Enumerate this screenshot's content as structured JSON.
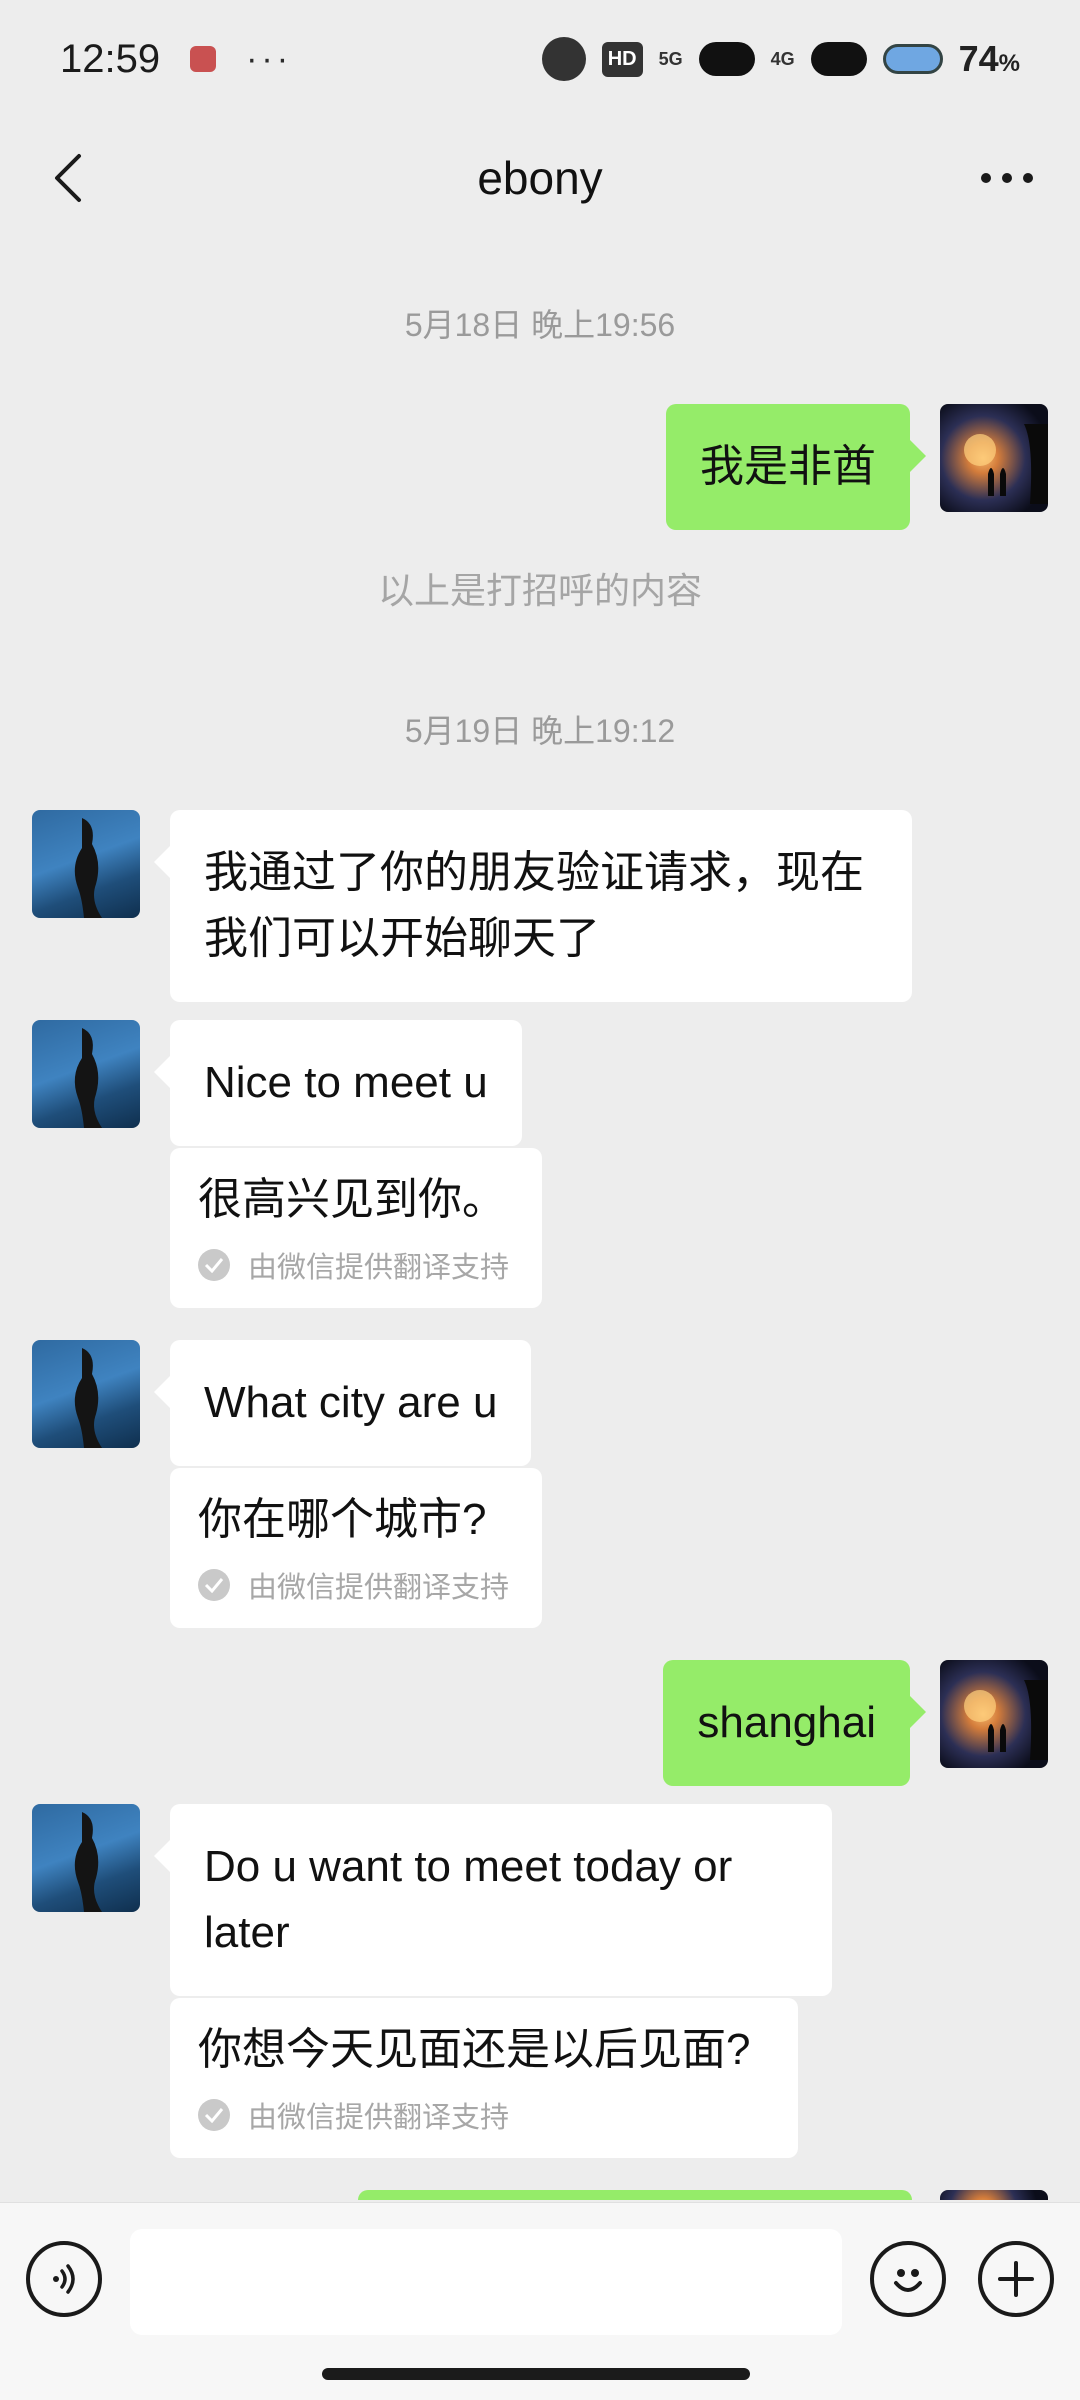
{
  "status_bar": {
    "time": "12:59",
    "dots": "···",
    "hd_label": "HD",
    "network_label_1": "5G",
    "network_label_2": "4G",
    "battery_level": "74",
    "battery_unit": "%"
  },
  "navbar": {
    "title": "ebony"
  },
  "chat": {
    "timestamp_1": "5月18日 晚上19:56",
    "timestamp_2": "5月19日 晚上19:12",
    "system_notice": "以上是打招呼的内容",
    "messages": [
      {
        "text": "我是非酋"
      },
      {
        "text": "我通过了你的朋友验证请求，现在我们可以开始聊天了"
      },
      {
        "text": "Nice to meet u",
        "translation": "很高兴见到你。"
      },
      {
        "text": "What city are u",
        "translation": "你在哪个城市?"
      },
      {
        "text": "shanghai"
      },
      {
        "text": "Do u want to meet today or later",
        "translation": "你想今天见面还是以后见面?"
      }
    ],
    "translation_credit": "由微信提供翻译支持"
  },
  "input_bar": {
    "placeholder": ""
  },
  "colors": {
    "background": "#ededed",
    "incoming_bubble": "#ffffff",
    "outgoing_bubble": "#95ec69",
    "timestamp_text": "#9a9a9a"
  }
}
